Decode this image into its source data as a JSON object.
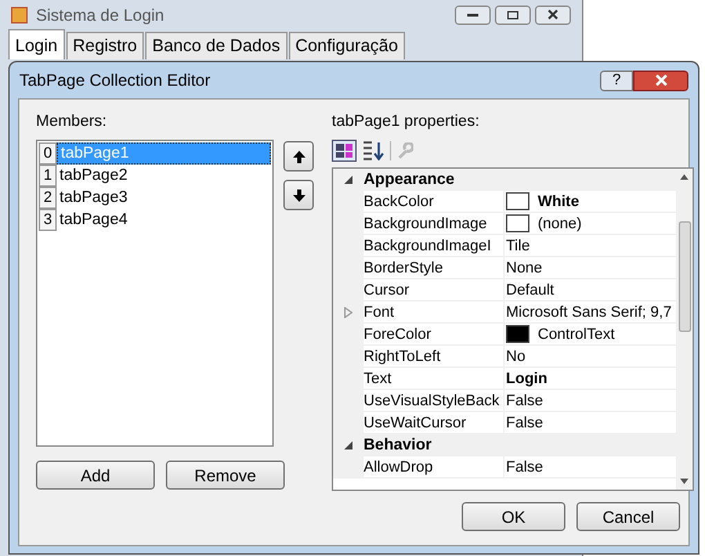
{
  "main_window": {
    "title": "Sistema de Login",
    "tabs": [
      {
        "label": "Login",
        "selected": true
      },
      {
        "label": "Registro",
        "selected": false
      },
      {
        "label": "Banco de Dados",
        "selected": false
      },
      {
        "label": "Configuração",
        "selected": false
      }
    ]
  },
  "dialog": {
    "title": "TabPage Collection Editor",
    "help": "?",
    "members": {
      "label": "Members:",
      "items": [
        {
          "index": "0",
          "name": "tabPage1",
          "selected": true
        },
        {
          "index": "1",
          "name": "tabPage2",
          "selected": false
        },
        {
          "index": "2",
          "name": "tabPage3",
          "selected": false
        },
        {
          "index": "3",
          "name": "tabPage4",
          "selected": false
        }
      ],
      "buttons": [
        "Add",
        "Remove"
      ]
    },
    "properties": {
      "label": "tabPage1 properties:",
      "rows": [
        {
          "kind": "category",
          "name": "Appearance",
          "expanded": true
        },
        {
          "kind": "property",
          "name": "BackColor",
          "value": "White",
          "color": "#ffffff",
          "bold": true,
          "expandable": false
        },
        {
          "kind": "property",
          "name": "BackgroundImage",
          "value": "(none)",
          "color": "#ffffff",
          "bold": false,
          "expandable": false
        },
        {
          "kind": "property",
          "name": "BackgroundImageI",
          "value": "Tile",
          "bold": false,
          "expandable": false
        },
        {
          "kind": "property",
          "name": "BorderStyle",
          "value": "None",
          "bold": false,
          "expandable": false
        },
        {
          "kind": "property",
          "name": "Cursor",
          "value": "Default",
          "bold": false,
          "expandable": false
        },
        {
          "kind": "property",
          "name": "Font",
          "value": "Microsoft Sans Serif; 9,7",
          "bold": false,
          "expandable": true
        },
        {
          "kind": "property",
          "name": "ForeColor",
          "value": "ControlText",
          "color": "#000000",
          "bold": false,
          "expandable": false
        },
        {
          "kind": "property",
          "name": "RightToLeft",
          "value": "No",
          "bold": false,
          "expandable": false
        },
        {
          "kind": "property",
          "name": "Text",
          "value": "Login",
          "bold": true,
          "expandable": false
        },
        {
          "kind": "property",
          "name": "UseVisualStyleBack",
          "value": "False",
          "bold": false,
          "expandable": false
        },
        {
          "kind": "property",
          "name": "UseWaitCursor",
          "value": "False",
          "bold": false,
          "expandable": false
        },
        {
          "kind": "category",
          "name": "Behavior",
          "expanded": true
        },
        {
          "kind": "property",
          "name": "AllowDrop",
          "value": "False",
          "bold": false,
          "expandable": false
        }
      ]
    },
    "buttons": [
      "OK",
      "Cancel"
    ]
  }
}
